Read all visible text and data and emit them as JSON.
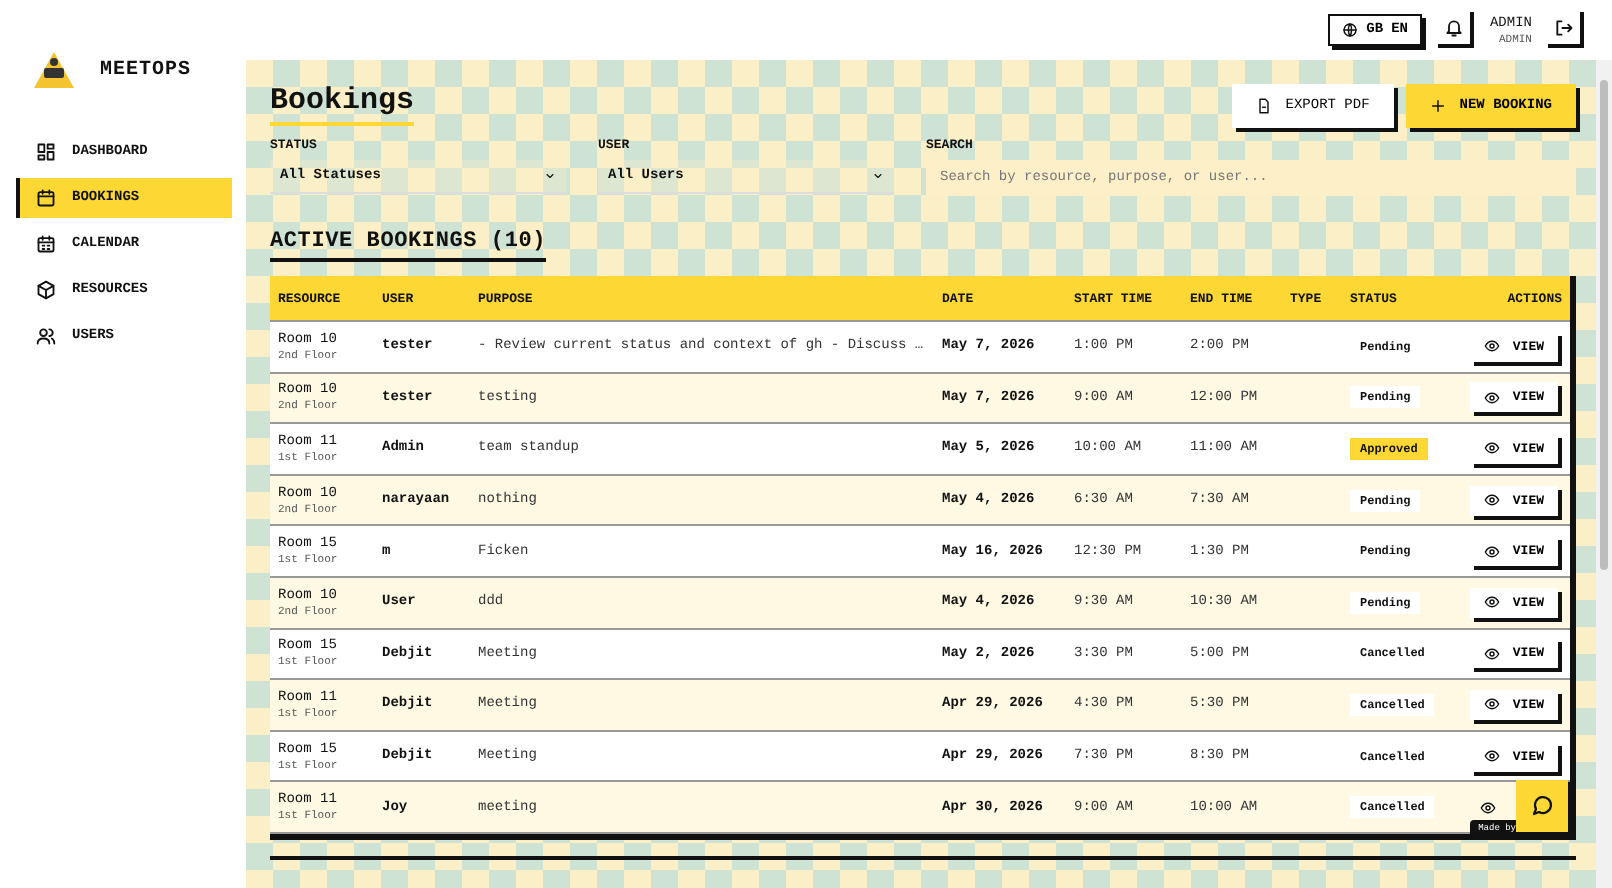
{
  "app": {
    "name": "MEETOPS"
  },
  "sidebar": {
    "items": [
      {
        "label": "DASHBOARD",
        "selected": false
      },
      {
        "label": "BOOKINGS",
        "selected": true
      },
      {
        "label": "CALENDAR",
        "selected": false
      },
      {
        "label": "RESOURCES",
        "selected": false
      },
      {
        "label": "USERS",
        "selected": false
      }
    ]
  },
  "header": {
    "language": {
      "flag": "GB",
      "code": "EN"
    },
    "user": {
      "name": "ADMIN",
      "role": "ADMIN"
    }
  },
  "page": {
    "title": "Bookings",
    "actions": [
      {
        "label": "EXPORT PDF",
        "kind": "secondary"
      },
      {
        "label": "NEW BOOKING",
        "kind": "primary"
      }
    ]
  },
  "filters": [
    {
      "label": "STATUS",
      "kind": "select",
      "value": "All Statuses"
    },
    {
      "label": "USER",
      "kind": "select",
      "value": "All Users"
    },
    {
      "label": "SEARCH",
      "kind": "search",
      "placeholder": "Search by resource, purpose, or user..."
    }
  ],
  "section": {
    "title": "ACTIVE BOOKINGS (10)"
  },
  "table": {
    "columns": [
      "RESOURCE",
      "USER",
      "PURPOSE",
      "DATE",
      "START TIME",
      "END TIME",
      "TYPE",
      "STATUS",
      "ACTIONS"
    ],
    "rows": [
      {
        "resource": "Room 10",
        "floor": "2nd Floor",
        "user": "tester",
        "purpose": "- Review current status and context of gh - Discuss …",
        "date": "May 7, 2026",
        "start": "1:00 PM",
        "end": "2:00 PM",
        "status": "Pending",
        "highlighted": false,
        "action": "VIEW"
      },
      {
        "resource": "Room 10",
        "floor": "2nd Floor",
        "user": "tester",
        "purpose": "testing",
        "date": "May 7, 2026",
        "start": "9:00 AM",
        "end": "12:00 PM",
        "status": "Pending",
        "highlighted": false,
        "action": "VIEW"
      },
      {
        "resource": "Room 11",
        "floor": "1st Floor",
        "user": "Admin",
        "purpose": "team standup",
        "date": "May 5, 2026",
        "start": "10:00 AM",
        "end": "11:00 AM",
        "status": "Approved",
        "highlighted": true,
        "action": "VIEW"
      },
      {
        "resource": "Room 10",
        "floor": "2nd Floor",
        "user": "narayaan",
        "purpose": "nothing",
        "date": "May 4, 2026",
        "start": "6:30 AM",
        "end": "7:30 AM",
        "status": "Pending",
        "highlighted": false,
        "action": "VIEW"
      },
      {
        "resource": "Room 15",
        "floor": "1st Floor",
        "user": "m",
        "purpose": "Ficken",
        "date": "May 16, 2026",
        "start": "12:30 PM",
        "end": "1:30 PM",
        "status": "Pending",
        "highlighted": false,
        "action": "VIEW"
      },
      {
        "resource": "Room 10",
        "floor": "2nd Floor",
        "user": "User",
        "purpose": "ddd",
        "date": "May 4, 2026",
        "start": "9:30 AM",
        "end": "10:30 AM",
        "status": "Pending",
        "highlighted": false,
        "action": "VIEW"
      },
      {
        "resource": "Room 15",
        "floor": "1st Floor",
        "user": "Debjit",
        "purpose": "Meeting",
        "date": "May 2, 2026",
        "start": "3:30 PM",
        "end": "5:00 PM",
        "status": "Cancelled",
        "highlighted": false,
        "action": "VIEW"
      },
      {
        "resource": "Room 11",
        "floor": "1st Floor",
        "user": "Debjit",
        "purpose": "Meeting",
        "date": "Apr 29, 2026",
        "start": "4:30 PM",
        "end": "5:30 PM",
        "status": "Cancelled",
        "highlighted": false,
        "action": "VIEW"
      },
      {
        "resource": "Room 15",
        "floor": "1st Floor",
        "user": "Debjit",
        "purpose": "Meeting",
        "date": "Apr 29, 2026",
        "start": "7:30 PM",
        "end": "8:30 PM",
        "status": "Cancelled",
        "highlighted": false,
        "action": "VIEW"
      },
      {
        "resource": "Room 11",
        "floor": "1st Floor",
        "user": "Joy",
        "purpose": "meeting",
        "date": "Apr 30, 2026",
        "start": "9:00 AM",
        "end": "10:00 AM",
        "status": "Cancelled",
        "highlighted": false
      }
    ]
  },
  "chat": {
    "badge": "Made by"
  }
}
